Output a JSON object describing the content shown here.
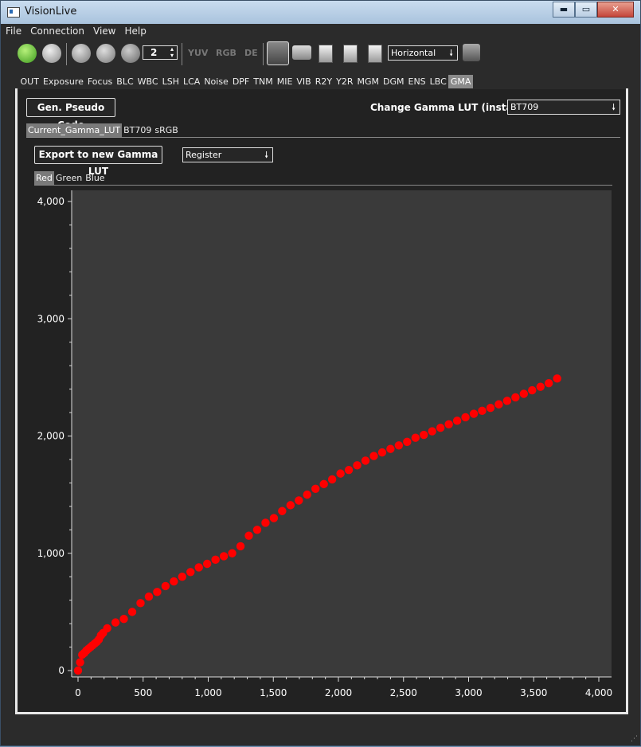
{
  "window": {
    "title": "VisionLive",
    "min_label": "▬",
    "max_label": "▭",
    "close_label": "✕"
  },
  "menu": [
    "File",
    "Connection",
    "View",
    "Help"
  ],
  "toolbar": {
    "frame_count": "2",
    "yuv": "YUV",
    "rgb": "RGB",
    "de": "DE",
    "orientation": "Horizontal"
  },
  "tabs": [
    "OUT",
    "Exposure",
    "Focus",
    "BLC",
    "WBC",
    "LSH",
    "LCA",
    "Noise",
    "DPF",
    "TNM",
    "MIE",
    "VIB",
    "R2Y",
    "Y2R",
    "MGM",
    "DGM",
    "ENS",
    "LBC",
    "GMA"
  ],
  "active_tab": "GMA",
  "gma": {
    "gen_pseudo_code": "Gen. Pseudo Code",
    "change_lut_label": "Change Gamma LUT (instant)",
    "change_lut_value": "BT709",
    "lut_tabs": [
      "Current_Gamma_LUT",
      "BT709",
      "sRGB"
    ],
    "export_label": "Export to new Gamma LUT",
    "export_mode": "Register",
    "channel_tabs": [
      "Red",
      "Green",
      "Blue"
    ]
  },
  "colors": {
    "points": "#ff0000",
    "plot_bg": "#3a3a3a",
    "panel_bg": "#222222"
  },
  "chart_data": {
    "type": "scatter",
    "title": "",
    "xlabel": "",
    "ylabel": "",
    "xlim": [
      0,
      4000
    ],
    "ylim": [
      0,
      4000
    ],
    "xticks": [
      "0",
      "500",
      "1,000",
      "1,500",
      "2,000",
      "2,500",
      "3,000",
      "3,500",
      "4,000"
    ],
    "yticks": [
      "0",
      "1,000",
      "2,000",
      "3,000",
      "4,000"
    ],
    "grid": false,
    "series": [
      {
        "color": "#ff0000",
        "x": [
          0,
          16,
          32,
          48,
          64,
          80,
          96,
          112,
          128,
          144,
          160,
          176,
          192,
          224,
          288,
          352,
          416,
          480,
          544,
          608,
          672,
          736,
          800,
          864,
          928,
          992,
          1056,
          1120,
          1184,
          1248,
          1312,
          1376,
          1440,
          1504,
          1568,
          1632,
          1696,
          1760,
          1824,
          1888,
          1952,
          2016,
          2080,
          2144,
          2208,
          2272,
          2336,
          2400,
          2464,
          2528,
          2592,
          2656,
          2720,
          2784,
          2848,
          2912,
          2976,
          3040,
          3104,
          3168,
          3232,
          3296,
          3360,
          3424,
          3488,
          3552,
          3616,
          3680
        ],
        "y": [
          0,
          70,
          135,
          150,
          170,
          185,
          200,
          215,
          230,
          245,
          265,
          300,
          320,
          360,
          410,
          440,
          500,
          575,
          630,
          670,
          720,
          760,
          800,
          840,
          880,
          910,
          945,
          975,
          1000,
          1060,
          1150,
          1200,
          1260,
          1300,
          1360,
          1410,
          1450,
          1500,
          1550,
          1590,
          1630,
          1680,
          1710,
          1750,
          1790,
          1830,
          1860,
          1890,
          1920,
          1950,
          1985,
          2010,
          2040,
          2070,
          2100,
          2130,
          2160,
          2190,
          2215,
          2240,
          2270,
          2300,
          2330,
          2360,
          2390,
          2420,
          2450,
          2490
        ]
      }
    ]
  }
}
